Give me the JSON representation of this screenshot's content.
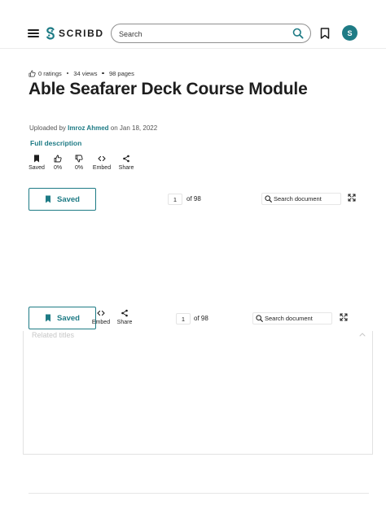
{
  "header": {
    "logo_text": "SCRIBD",
    "search_placeholder": "Search",
    "avatar_initial": "S"
  },
  "document": {
    "ratings": "0 ratings",
    "views": "34 views",
    "pages": "98 pages",
    "title": "Able Seafarer Deck Course Module",
    "uploaded_prefix": "Uploaded by",
    "author": "Imroz Ahmed",
    "date_prefix": "on",
    "date": "Jan 18, 2022",
    "full_description_label": "Full description"
  },
  "actions": [
    {
      "label": "Saved",
      "icon": "bookmark-filled-icon"
    },
    {
      "label": "0%",
      "icon": "thumbs-up-icon"
    },
    {
      "label": "0%",
      "icon": "thumbs-down-icon"
    },
    {
      "label": "Embed",
      "icon": "embed-code-icon"
    },
    {
      "label": "Share",
      "icon": "share-icon"
    }
  ],
  "toolbar_top": {
    "saved_label": "Saved",
    "current_page": "1",
    "page_total": "of 98",
    "search_document": "Search document"
  },
  "toolbar_bottom": {
    "saved_label": "Saved",
    "embed_label": "Embed",
    "share_label": "Share",
    "current_page": "1",
    "page_total": "of 98",
    "search_document": "Search document"
  },
  "related": {
    "title": "Related titles"
  },
  "colors": {
    "accent": "#1e7b85",
    "text": "#1e1e1e",
    "border": "#e2e2e2"
  }
}
